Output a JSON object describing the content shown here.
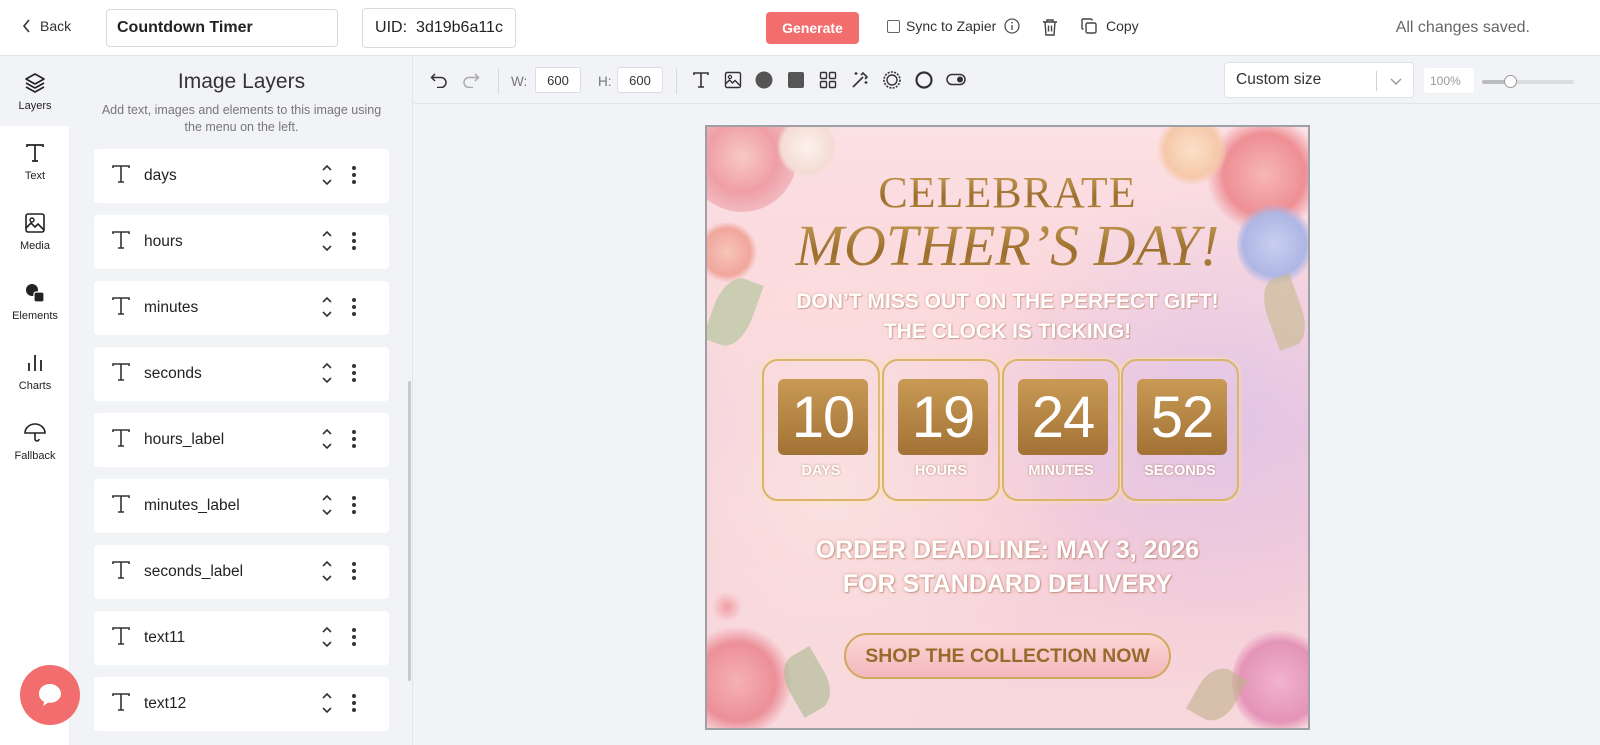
{
  "topbar": {
    "back_label": "Back",
    "template_name": "Countdown Timer",
    "uid_label": "UID:",
    "uid_value": "3d19b6a11c",
    "generate_label": "Generate",
    "sync_label": "Sync to Zapier",
    "copy_label": "Copy",
    "status": "All changes saved."
  },
  "sidenav": [
    {
      "label": "Layers",
      "icon": "layers-icon"
    },
    {
      "label": "Text",
      "icon": "text-icon"
    },
    {
      "label": "Media",
      "icon": "image-icon"
    },
    {
      "label": "Elements",
      "icon": "shapes-icon"
    },
    {
      "label": "Charts",
      "icon": "bar-chart-icon"
    },
    {
      "label": "Fallback",
      "icon": "umbrella-icon"
    }
  ],
  "layers_panel": {
    "title": "Image Layers",
    "subtitle": "Add text, images and elements to this image using the menu on the left.",
    "layers": [
      {
        "name": "days",
        "type": "text"
      },
      {
        "name": "hours",
        "type": "text"
      },
      {
        "name": "minutes",
        "type": "text"
      },
      {
        "name": "seconds",
        "type": "text"
      },
      {
        "name": "hours_label",
        "type": "text"
      },
      {
        "name": "minutes_label",
        "type": "text"
      },
      {
        "name": "seconds_label",
        "type": "text"
      },
      {
        "name": "text11",
        "type": "text"
      },
      {
        "name": "text12",
        "type": "text"
      }
    ]
  },
  "toolbar": {
    "width_label": "W:",
    "width_value": "600",
    "height_label": "H:",
    "height_value": "600",
    "size_preset": "Custom size",
    "zoom": "100%",
    "zoom_level": 0.3
  },
  "design": {
    "line1": "CELEBRATE",
    "line2": "MOTHER’S DAY!",
    "sub1": "DON’T MISS OUT ON THE PERFECT GIFT!",
    "sub2": "THE CLOCK IS TICKING!",
    "countdown": [
      {
        "value": "10",
        "label": "DAYS"
      },
      {
        "value": "19",
        "label": "HOURS"
      },
      {
        "value": "24",
        "label": "MINUTES"
      },
      {
        "value": "52",
        "label": "SECONDS"
      }
    ],
    "order1": "ORDER DEADLINE: MAY 3, 2026",
    "order2": "FOR STANDARD DELIVERY",
    "cta": "SHOP THE COLLECTION NOW",
    "accent_gold": "#b68640",
    "accent_red": "#f26d6d"
  }
}
